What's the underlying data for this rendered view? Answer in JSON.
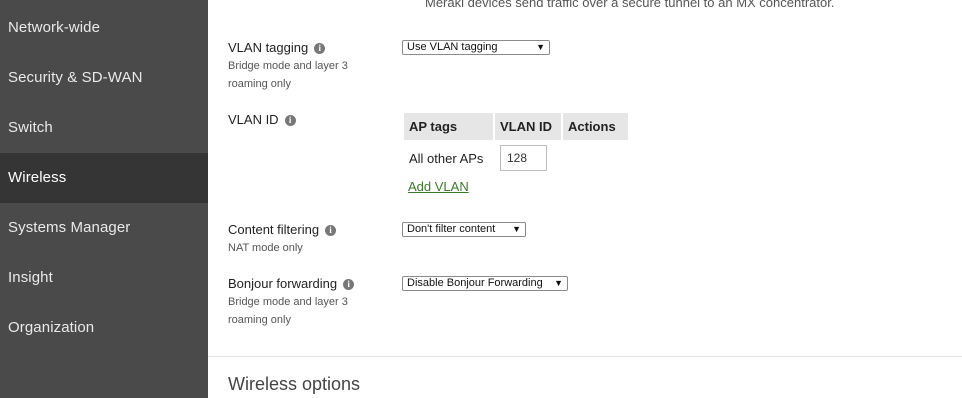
{
  "sidebar": {
    "items": [
      {
        "label": "Network-wide"
      },
      {
        "label": "Security & SD-WAN"
      },
      {
        "label": "Switch"
      },
      {
        "label": "Wireless",
        "active": true
      },
      {
        "label": "Systems Manager"
      },
      {
        "label": "Insight"
      },
      {
        "label": "Organization"
      }
    ]
  },
  "main": {
    "top_note": "Meraki devices send traffic over a secure tunnel to an MX concentrator.",
    "vlan_tagging": {
      "label": "VLAN tagging",
      "sub": "Bridge mode and layer 3 roaming only",
      "select_value": "Use VLAN tagging"
    },
    "vlan_id": {
      "label": "VLAN ID",
      "table": {
        "headers": [
          "AP tags",
          "VLAN ID",
          "Actions"
        ],
        "row": {
          "ap_tags": "All other APs",
          "vlan_id": "128"
        },
        "add_link": "Add VLAN"
      }
    },
    "content_filtering": {
      "label": "Content filtering",
      "sub": "NAT mode only",
      "select_value": "Don't filter content"
    },
    "bonjour": {
      "label": "Bonjour forwarding",
      "sub": "Bridge mode and layer 3 roaming only",
      "select_value": "Disable Bonjour Forwarding"
    },
    "section_title": "Wireless options"
  },
  "icons": {
    "info": "info-icon",
    "dropdown": "chevron-down-icon"
  },
  "colors": {
    "sidebar_bg": "#4a4a4a",
    "sidebar_active_bg": "#353535",
    "link_green": "#3a7a2a",
    "table_header_bg": "#e6e6e6"
  }
}
